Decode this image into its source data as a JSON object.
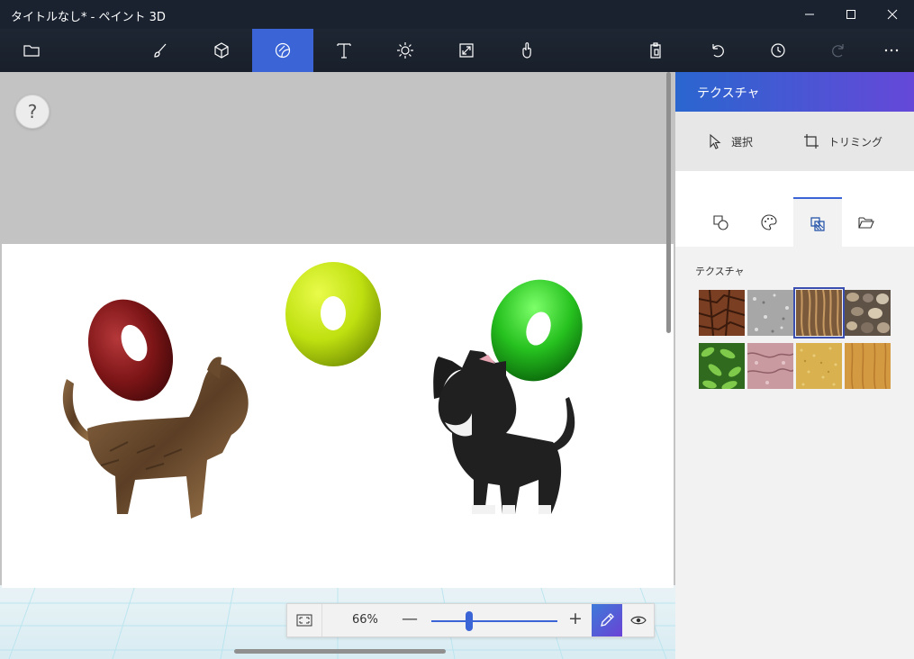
{
  "window": {
    "title": "タイトルなし* - ペイント 3D",
    "controls": [
      "minimize-icon",
      "maximize-icon",
      "close-icon"
    ]
  },
  "toolbar": {
    "left_tools": [
      "folder-icon"
    ],
    "tools": [
      {
        "name": "brushes",
        "icon": "brush-icon",
        "active": false
      },
      {
        "name": "3d-shapes",
        "icon": "cube-icon",
        "active": false
      },
      {
        "name": "stickers",
        "icon": "sticker-icon",
        "active": true
      },
      {
        "name": "text",
        "icon": "text-icon",
        "active": false
      },
      {
        "name": "effects",
        "icon": "sun-icon",
        "active": false
      },
      {
        "name": "canvas",
        "icon": "resize-icon",
        "active": false
      },
      {
        "name": "mixed-reality",
        "icon": "hand-icon",
        "active": false
      }
    ],
    "right_tools": [
      "paste-icon",
      "undo-icon",
      "history-icon",
      "redo-icon",
      "more-icon"
    ]
  },
  "canvas": {
    "help_label": "?"
  },
  "zoom": {
    "value_label": "66%",
    "minus_label": "—",
    "plus_label": "+",
    "slider_fraction": 0.3
  },
  "panel": {
    "header": "テクスチャ",
    "select_label": "選択",
    "crop_label": "トリミング",
    "tabs": [
      "shapes-icon",
      "palette-icon",
      "texture-icon",
      "folder-icon"
    ],
    "active_tab": 2,
    "section_label": "テクスチャ",
    "textures": [
      {
        "name": "bark",
        "selected": false
      },
      {
        "name": "granite",
        "selected": false
      },
      {
        "name": "hair",
        "selected": true
      },
      {
        "name": "pebbles",
        "selected": false
      },
      {
        "name": "leaves",
        "selected": false
      },
      {
        "name": "marble",
        "selected": false
      },
      {
        "name": "sand",
        "selected": false
      },
      {
        "name": "wood",
        "selected": false
      }
    ]
  },
  "colors": {
    "accent": "#3b64d6",
    "title_bg": "#1a2230",
    "panel_header_start": "#2a66cf",
    "panel_header_end": "#6548d8"
  }
}
